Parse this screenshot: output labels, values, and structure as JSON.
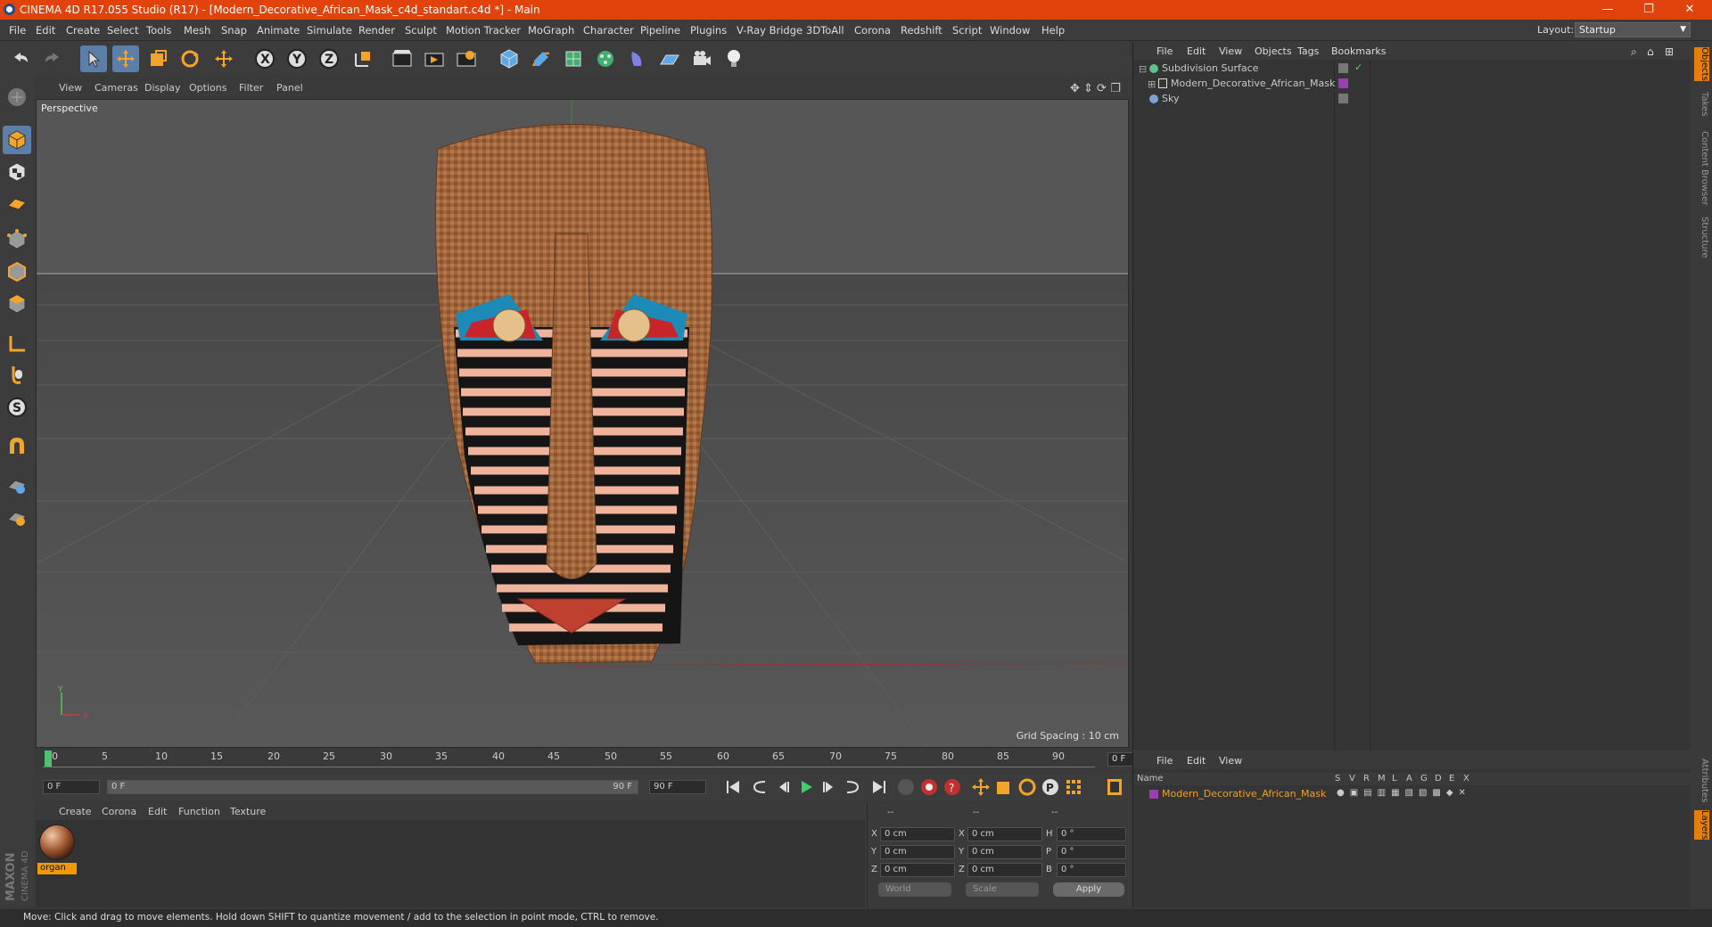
{
  "window": {
    "title": "CINEMA 4D R17.055 Studio (R17) - [Modern_Decorative_African_Mask_c4d_standart.c4d *] - Main",
    "controls": [
      "—",
      "❐",
      "✕"
    ]
  },
  "menubar": {
    "items": [
      "File",
      "Edit",
      "Create",
      "Select",
      "Tools",
      "Mesh",
      "Snap",
      "Animate",
      "Simulate",
      "Render",
      "Sculpt",
      "Motion Tracker",
      "MoGraph",
      "Character",
      "Pipeline",
      "Plugins",
      "V-Ray Bridge",
      "3DToAll",
      "Corona",
      "Redshift",
      "Script",
      "Window",
      "Help"
    ],
    "layout_label": "Layout:",
    "layout_value": "Startup"
  },
  "toolbar": {
    "icons": [
      "undo-icon",
      "redo-icon",
      "select-icon",
      "move-icon",
      "scale-icon",
      "rotate-icon",
      "live-select-icon",
      "x-axis-icon",
      "y-axis-icon",
      "z-axis-icon",
      "coord-system-icon",
      "render-view-icon",
      "render-picture-icon",
      "render-settings-icon",
      "cube-icon",
      "pen-icon",
      "subdivision-icon",
      "cloner-icon",
      "deformer-icon",
      "floor-icon",
      "camera-icon",
      "light-icon"
    ],
    "axis_labels": [
      "X",
      "Y",
      "Z"
    ]
  },
  "left_tools": {
    "icons": [
      "make-editable-icon",
      "model-mode-icon",
      "texture-mode-icon",
      "workplane-icon",
      "points-mode-icon",
      "edges-mode-icon",
      "polygons-mode-icon",
      "axis-icon",
      "tweak-icon",
      "solo-icon",
      "magnet-icon",
      "snap-icon",
      "enable-snap-icon"
    ],
    "solo_letter": "S"
  },
  "viewport": {
    "menu": [
      "View",
      "Cameras",
      "Display",
      "Options",
      "Filter",
      "Panel"
    ],
    "label": "Perspective",
    "grid_info": "Grid Spacing : 10 cm",
    "axis_y": "Y",
    "axis_x": "X"
  },
  "timeline": {
    "ticks": [
      "0",
      "5",
      "10",
      "15",
      "20",
      "25",
      "30",
      "35",
      "40",
      "45",
      "50",
      "55",
      "60",
      "65",
      "70",
      "75",
      "80",
      "85",
      "90"
    ],
    "current_frame": "0 F"
  },
  "transport": {
    "start_field": "0 F",
    "range_start": "0 F",
    "range_end": "90 F",
    "end_field": "90 F"
  },
  "material_panel": {
    "menu": [
      "Create",
      "Corona",
      "Edit",
      "Function",
      "Texture"
    ],
    "material_name": "organ"
  },
  "coord_panel": {
    "header": [
      "--",
      "--",
      "--"
    ],
    "rows": [
      {
        "l1": "X",
        "v1": "0 cm",
        "l2": "X",
        "v2": "0 cm",
        "l3": "H",
        "v3": "0 °"
      },
      {
        "l1": "Y",
        "v1": "0 cm",
        "l2": "Y",
        "v2": "0 cm",
        "l3": "P",
        "v3": "0 °"
      },
      {
        "l1": "Z",
        "v1": "0 cm",
        "l2": "Z",
        "v2": "0 cm",
        "l3": "B",
        "v3": "0 °"
      }
    ],
    "world_dropdown": "World",
    "scale_dropdown": "Scale",
    "apply_label": "Apply"
  },
  "object_manager": {
    "menu": [
      "File",
      "Edit",
      "View",
      "Objects",
      "Tags",
      "Bookmarks"
    ],
    "objects": [
      {
        "name": "Subdivision Surface",
        "color": "#5fc08a"
      },
      {
        "name": "Modern_Decorative_African_Mask",
        "color": "#9b3fb0"
      },
      {
        "name": "Sky",
        "color": "#7aa3d2"
      }
    ]
  },
  "layer_manager": {
    "menu": [
      "File",
      "Edit",
      "View"
    ],
    "columns": [
      "Name",
      "S",
      "V",
      "R",
      "M",
      "L",
      "A",
      "G",
      "D",
      "E",
      "X"
    ],
    "layers": [
      {
        "name": "Modern_Decorative_African_Mask",
        "color": "#9b3fb0"
      }
    ]
  },
  "right_tabs": [
    "Objects",
    "Takes",
    "Content Browser",
    "Structure",
    "Attributes",
    "Layers"
  ],
  "status": "Move: Click and drag to move elements. Hold down SHIFT to quantize movement / add to the selection in point mode, CTRL to remove.",
  "branding": {
    "line1": "MAXON",
    "line2": "CINEMA 4D"
  },
  "colors": {
    "title_bar": "#e2420c",
    "selected_tool": "#5b7fa8",
    "accent_orange": "#f09a00",
    "layer_purple": "#9b3fb0"
  }
}
